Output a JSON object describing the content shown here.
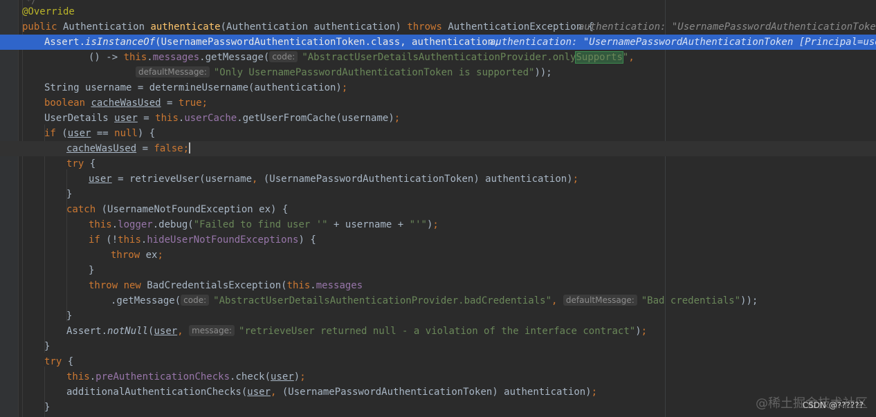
{
  "hints": {
    "authentication_a": "authentication: \"UsernamePasswordAuthenticationToken [",
    "authentication_b": "authentication: \"UsernamePasswordAuthenticationToken [Principal=user,",
    "code": "code:",
    "defaultMessage": "defaultMessage:",
    "message": "message:"
  },
  "code": {
    "top_fold": "*/",
    "annotation": "@Override",
    "l2": [
      "public",
      " Authentication ",
      "authenticate",
      "(Authentication authentication) ",
      "throws",
      " AuthenticationException {"
    ],
    "l3": [
      "Assert.",
      "isInstanceOf",
      "(UsernamePasswordAuthenticationToken.",
      "class",
      ", authentication,"
    ],
    "l4": [
      "() -> ",
      "this",
      ".",
      "messages",
      ".getMessage(",
      "\"AbstractUserDetailsAuthenticationProvider.only",
      "Supports",
      "\"",
      ","
    ],
    "l5": [
      "\"Only UsernamePasswordAuthenticationToken is supported\"",
      "));"
    ],
    "l6": [
      "String username = determineUsername(authentication)",
      ";"
    ],
    "l7": [
      "boolean",
      " ",
      "cacheWasUsed",
      " = ",
      "true",
      ";"
    ],
    "l8": [
      "UserDetails ",
      "user",
      " = ",
      "this",
      ".",
      "userCache",
      ".getUserFromCache(username)",
      ";"
    ],
    "l9": [
      "if",
      " (",
      "user",
      " == ",
      "null",
      ") {"
    ],
    "l10": [
      "cacheWasUsed",
      " = ",
      "false",
      ";"
    ],
    "l11": [
      "try",
      " {"
    ],
    "l12": [
      "user",
      " = retrieveUser(username",
      ",",
      " (UsernamePasswordAuthenticationToken) authentication)",
      ";"
    ],
    "l13": "}",
    "l14": [
      "catch",
      " (UsernameNotFoundException ex) {"
    ],
    "l15": [
      "this",
      ".",
      "logger",
      ".debug(",
      "\"Failed to find user '\"",
      " + username + ",
      "\"'\"",
      ")",
      ";"
    ],
    "l16": [
      "if",
      " (!",
      "this",
      ".",
      "hideUserNotFoundExceptions",
      ") {"
    ],
    "l17": [
      "throw",
      " ex",
      ";"
    ],
    "l18": "}",
    "l19": [
      "throw new",
      " BadCredentialsException(",
      "this",
      ".",
      "messages"
    ],
    "l20": [
      ".getMessage(",
      "\"AbstractUserDetailsAuthenticationProvider.badCredentials\"",
      ",",
      "\"Bad credentials\"",
      "));"
    ],
    "l21": "}",
    "l22": [
      "Assert.",
      "notNull",
      "(",
      "user",
      ",",
      "\"retrieveUser returned null - a violation of the interface contract\"",
      ")",
      ";"
    ],
    "l23": "}",
    "l24": [
      "try",
      " {"
    ],
    "l25": [
      "this",
      ".",
      "preAuthenticationChecks",
      ".check(",
      "user",
      ")",
      ";"
    ],
    "l26": [
      "additionalAuthenticationChecks(",
      "user",
      ",",
      " (UsernamePasswordAuthenticationToken) authentication)",
      ";"
    ],
    "l27": "}"
  },
  "watermark": {
    "text": "@稀土掘金技术社区",
    "csdn": "CSDN @??????"
  },
  "colors": {
    "background": "#2b2b2b",
    "selection": "#2f65ca",
    "keyword": "#cc7832",
    "string": "#6a8759",
    "field": "#9876aa",
    "method_decl": "#ffc66d",
    "annotation": "#bbb529"
  }
}
